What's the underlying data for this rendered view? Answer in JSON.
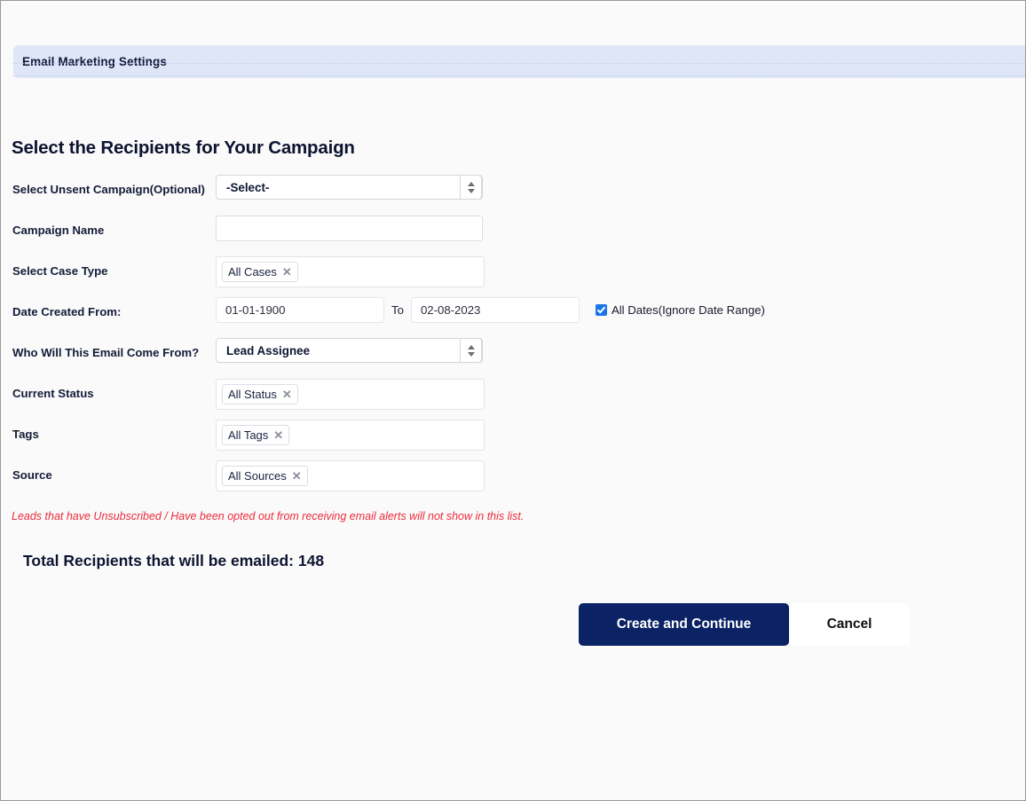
{
  "header": {
    "band_title": "Email Marketing Settings"
  },
  "page": {
    "heading": "Select the Recipients for Your Campaign",
    "note": "Leads that have Unsubscribed / Have been opted out from receiving email alerts will not show in this list.",
    "total_recipients": "Total Recipients that will be emailed: 148"
  },
  "form": {
    "unsent_campaign": {
      "label": "Select Unsent Campaign(Optional)",
      "value": "-Select-"
    },
    "campaign_name": {
      "label": "Campaign Name",
      "value": "",
      "placeholder": ""
    },
    "case_type": {
      "label": "Select Case Type",
      "tokens": [
        "All Cases"
      ]
    },
    "date_created": {
      "label": "Date Created From:",
      "from": "01-01-1900",
      "to_label": "To",
      "to": "02-08-2023",
      "all_dates_label": "All Dates(Ignore Date Range)",
      "all_dates_checked": true
    },
    "sender": {
      "label": "Who Will This Email Come From?",
      "value": "Lead Assignee"
    },
    "current_status": {
      "label": "Current Status",
      "tokens": [
        "All Status"
      ]
    },
    "tags": {
      "label": "Tags",
      "tokens": [
        "All Tags"
      ]
    },
    "source": {
      "label": "Source",
      "tokens": [
        "All Sources"
      ]
    },
    "token_remove_icon": "✕"
  },
  "actions": {
    "primary_label": "Create and Continue",
    "secondary_label": "Cancel"
  },
  "colors": {
    "band": "#dfe6f7",
    "primary_button": "#0b2265",
    "note_text": "#ec2b3c",
    "checkbox": "#1a73e8"
  }
}
